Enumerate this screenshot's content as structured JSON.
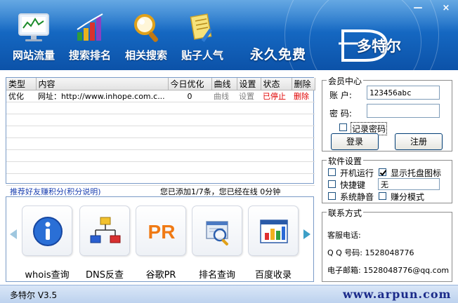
{
  "window": {
    "minimize_label": "—",
    "close_label": "×"
  },
  "header": {
    "nav": [
      {
        "label": "网站流量",
        "icon": "monitor-chart-icon"
      },
      {
        "label": "搜索排名",
        "icon": "bar-chart-icon"
      },
      {
        "label": "相关搜索",
        "icon": "magnifier-icon"
      },
      {
        "label": "贴子人气",
        "icon": "note-paper-icon"
      }
    ],
    "slogan": "永久免费",
    "logo_text": "多特尔"
  },
  "table": {
    "columns": [
      "类型",
      "内容",
      "今日优化",
      "曲线",
      "设置",
      "状态",
      "删除"
    ],
    "rows": [
      {
        "type": "优化",
        "content": "网址：http://www.inhope.com.c...",
        "today": "0",
        "curve": "曲线",
        "settings": "设置",
        "status": "已停止",
        "delete": "删除"
      }
    ]
  },
  "status_bar": {
    "referral_link": "推荐好友赚积分(积分说明)",
    "info": "您已添加1/7条，您已经在线 0分钟"
  },
  "tools": [
    {
      "label": "whois查询",
      "icon": "info-icon"
    },
    {
      "label": "DNS反查",
      "icon": "network-tree-icon"
    },
    {
      "label": "谷歌PR",
      "icon": "pr-icon"
    },
    {
      "label": "排名查询",
      "icon": "document-search-icon"
    },
    {
      "label": "百度收录",
      "icon": "window-chart-icon"
    }
  ],
  "member": {
    "title": "会员中心",
    "account_label": "账 户:",
    "account_value": "123456abc",
    "password_label": "密 码:",
    "password_value": "",
    "remember_label": "记录密码",
    "remember_checked": false,
    "login_label": "登录",
    "register_label": "注册"
  },
  "settings": {
    "title": "软件设置",
    "autostart_label": "开机运行",
    "autostart_checked": false,
    "tray_label": "显示托盘图标",
    "tray_checked": true,
    "hotkey_label": "快捷键",
    "hotkey_checked": false,
    "hotkey_value": "无",
    "mute_label": "系统静音",
    "mute_checked": false,
    "earn_label": "赚分模式",
    "earn_checked": false
  },
  "contact": {
    "title": "联系方式",
    "service": "客服电话:",
    "qq": "Q Q 号码: 1528048776",
    "email": "电子邮箱: 1528048776@qq.com"
  },
  "footer": {
    "version": "多特尔 V3.5",
    "url": "www.arpun.com"
  }
}
